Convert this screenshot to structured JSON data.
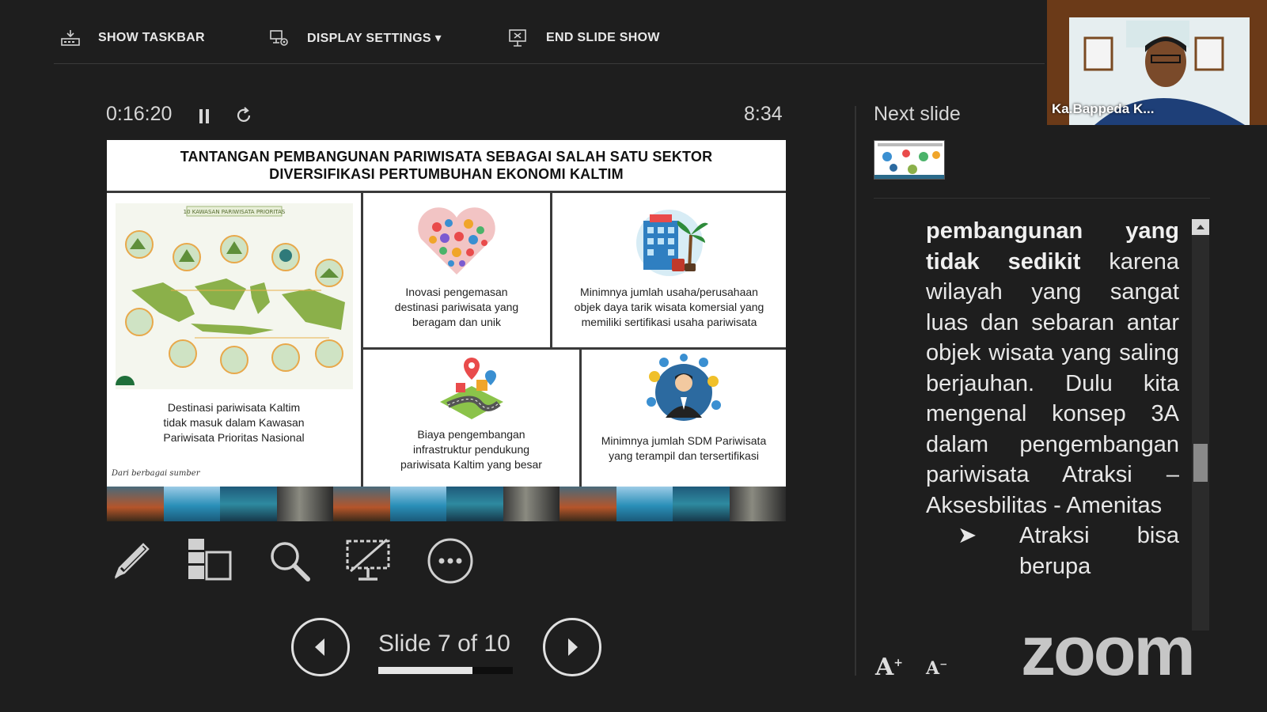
{
  "toolbar": {
    "show_taskbar": "SHOW TASKBAR",
    "display_settings": "DISPLAY SETTINGS ▾",
    "end_slide_show": "END SLIDE SHOW"
  },
  "timer": {
    "elapsed": "0:16:20",
    "clock": "8:34"
  },
  "slide": {
    "title_line1": "TANTANGAN PEMBANGUNAN PARIWISATA SEBAGAI SALAH SATU SEKTOR",
    "title_line2": "DIVERSIFIKASI PERTUMBUHAN EKONOMI KALTIM",
    "map_caption": "10 KAWASAN PARIWISATA PRIORITAS",
    "cell_map": "Destinasi pariwisata Kaltim tidak masuk dalam Kawasan Pariwisata Prioritas Nasional",
    "cell_heart": "Inovasi pengemasan destinasi pariwisata yang beragam dan unik",
    "cell_hotel": "Minimnya jumlah usaha/perusahaan objek daya tarik wisata komersial yang memiliki sertifikasi usaha pariwisata",
    "cell_road": "Biaya pengembangan infrastruktur pendukung pariwisata Kaltim yang besar",
    "cell_sdm": "Minimnya jumlah SDM Pariwisata yang terampil dan tersertifikasi",
    "source": "Dari berbagai sumber"
  },
  "navigation": {
    "counter": "Slide 7 of 10",
    "progress": 0.7
  },
  "next_slide": {
    "label": "Next slide"
  },
  "notes": {
    "bold_text": "pembangunan yang tidak sedikit",
    "body": " karena wilayah yang sangat luas dan sebaran antar objek wisata yang saling berjauhan. Dulu kita mengenal konsep 3A dalam pengembangan pariwisata Atraksi – Aksesbilitas - Amenitas",
    "bullet": "Atraksi bisa berupa"
  },
  "webcam": {
    "name": "Ka.Bappeda K..."
  },
  "watermark": "zoom",
  "colors": {
    "background": "#1e1e1e",
    "slide_bg": "#ffffff",
    "text": "#e6e6e6"
  }
}
